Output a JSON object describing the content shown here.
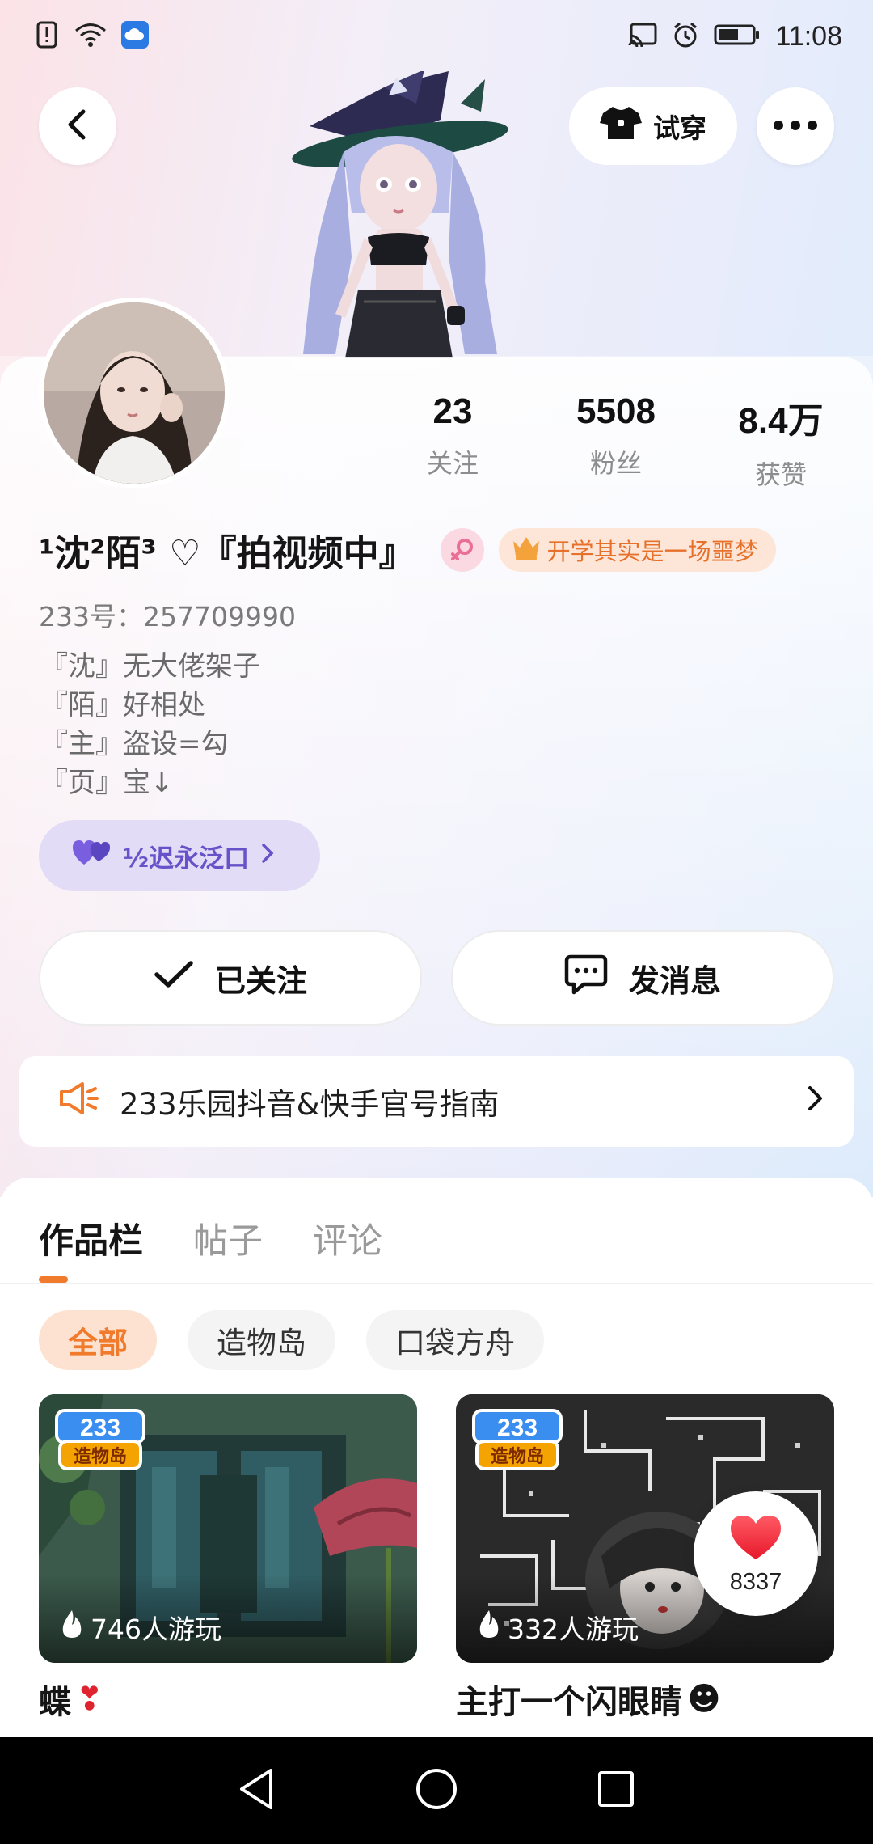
{
  "status_bar": {
    "time": "11:08",
    "icons_left": [
      "alert-icon",
      "wifi-icon",
      "cloud-app-icon"
    ],
    "icons_right": [
      "cast-icon",
      "alarm-icon",
      "battery-icon"
    ]
  },
  "header": {
    "back_icon": "chevron-left-icon",
    "tryon_label": "试穿",
    "tryon_icon": "tshirt-icon",
    "more_icon": "more-dots-icon"
  },
  "profile": {
    "stats": [
      {
        "value": "23",
        "label": "关注"
      },
      {
        "value": "5508",
        "label": "粉丝"
      },
      {
        "value": "8.4万",
        "label": "获赞"
      }
    ],
    "name": "¹沈²陌³ ♡『拍视频中』",
    "gender_icon": "female-icon",
    "title_badge": "开学其实是一场噩梦",
    "title_badge_icon": "crown-icon",
    "uid": "233号：257709990",
    "bio": [
      "『沈』无大佬架子",
      "『陌』好相处",
      "『主』盗设=勾",
      "『页』宝↓"
    ],
    "tag_chip": "½迟永泛口",
    "tag_chip_icon": "double-heart-icon"
  },
  "actions": {
    "follow_label": "已关注",
    "message_label": "发消息"
  },
  "notice": {
    "text": "233乐园抖音&快手官号指南",
    "icon": "megaphone-icon"
  },
  "tabs": [
    {
      "label": "作品栏",
      "active": true
    },
    {
      "label": "帖子",
      "active": false
    },
    {
      "label": "评论",
      "active": false
    }
  ],
  "filters": [
    {
      "label": "全部",
      "active": true
    },
    {
      "label": "造物岛",
      "active": false
    },
    {
      "label": "口袋方舟",
      "active": false
    }
  ],
  "cards": [
    {
      "plays": "746人游玩",
      "title": "蝶",
      "badge": "233造物岛",
      "emoji": "❣"
    },
    {
      "plays": "332人游玩",
      "title": "主打一个闪眼睛",
      "badge": "233造物岛",
      "emoji": "☻"
    }
  ],
  "like_bubble": {
    "count": "8337"
  },
  "colors": {
    "accent": "#f07b2c",
    "tag_purple": "#6852c9"
  }
}
